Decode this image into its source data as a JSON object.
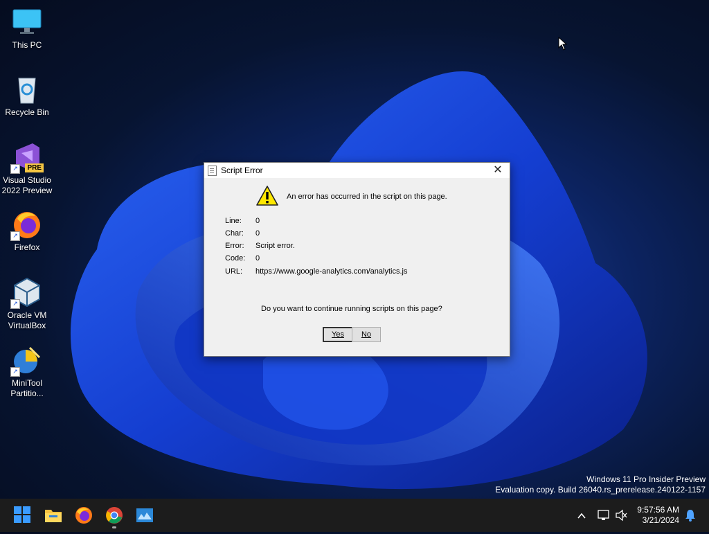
{
  "desktop": {
    "icons": [
      {
        "label": "This PC",
        "icon": "monitor-icon"
      },
      {
        "label": "Recycle Bin",
        "icon": "recycle-bin-icon"
      },
      {
        "label": "Visual Studio 2022 Preview",
        "icon": "visual-studio-icon",
        "badge": "PRE"
      },
      {
        "label": "Firefox",
        "icon": "firefox-icon"
      },
      {
        "label": "Oracle VM VirtualBox",
        "icon": "virtualbox-icon"
      },
      {
        "label": "MiniTool Partitio...",
        "icon": "minitool-icon"
      }
    ]
  },
  "dialog": {
    "title": "Script Error",
    "message": "An error has occurred in the script on this page.",
    "details": [
      {
        "label": "Line:",
        "value": "0"
      },
      {
        "label": "Char:",
        "value": "0"
      },
      {
        "label": "Error:",
        "value": "Script error."
      },
      {
        "label": "Code:",
        "value": "0"
      },
      {
        "label": "URL:",
        "value": "https://www.google-analytics.com/analytics.js"
      }
    ],
    "question": "Do you want to continue running scripts on this page?",
    "yes_label": "Yes",
    "no_label": "No"
  },
  "watermark": {
    "line1": "Windows 11 Pro Insider Preview",
    "line2": "Evaluation copy. Build 26040.rs_prerelease.240122-1157"
  },
  "taskbar": {
    "pinned": [
      "start-icon",
      "file-explorer-icon",
      "firefox-icon",
      "chrome-icon",
      "app-icon"
    ],
    "time": "9:57:56 AM",
    "date": "3/21/2024"
  },
  "colors": {
    "accent": "#1a6dff",
    "dialog_bg": "#f0f0f0",
    "taskbar_bg": "#1c1c1c"
  }
}
